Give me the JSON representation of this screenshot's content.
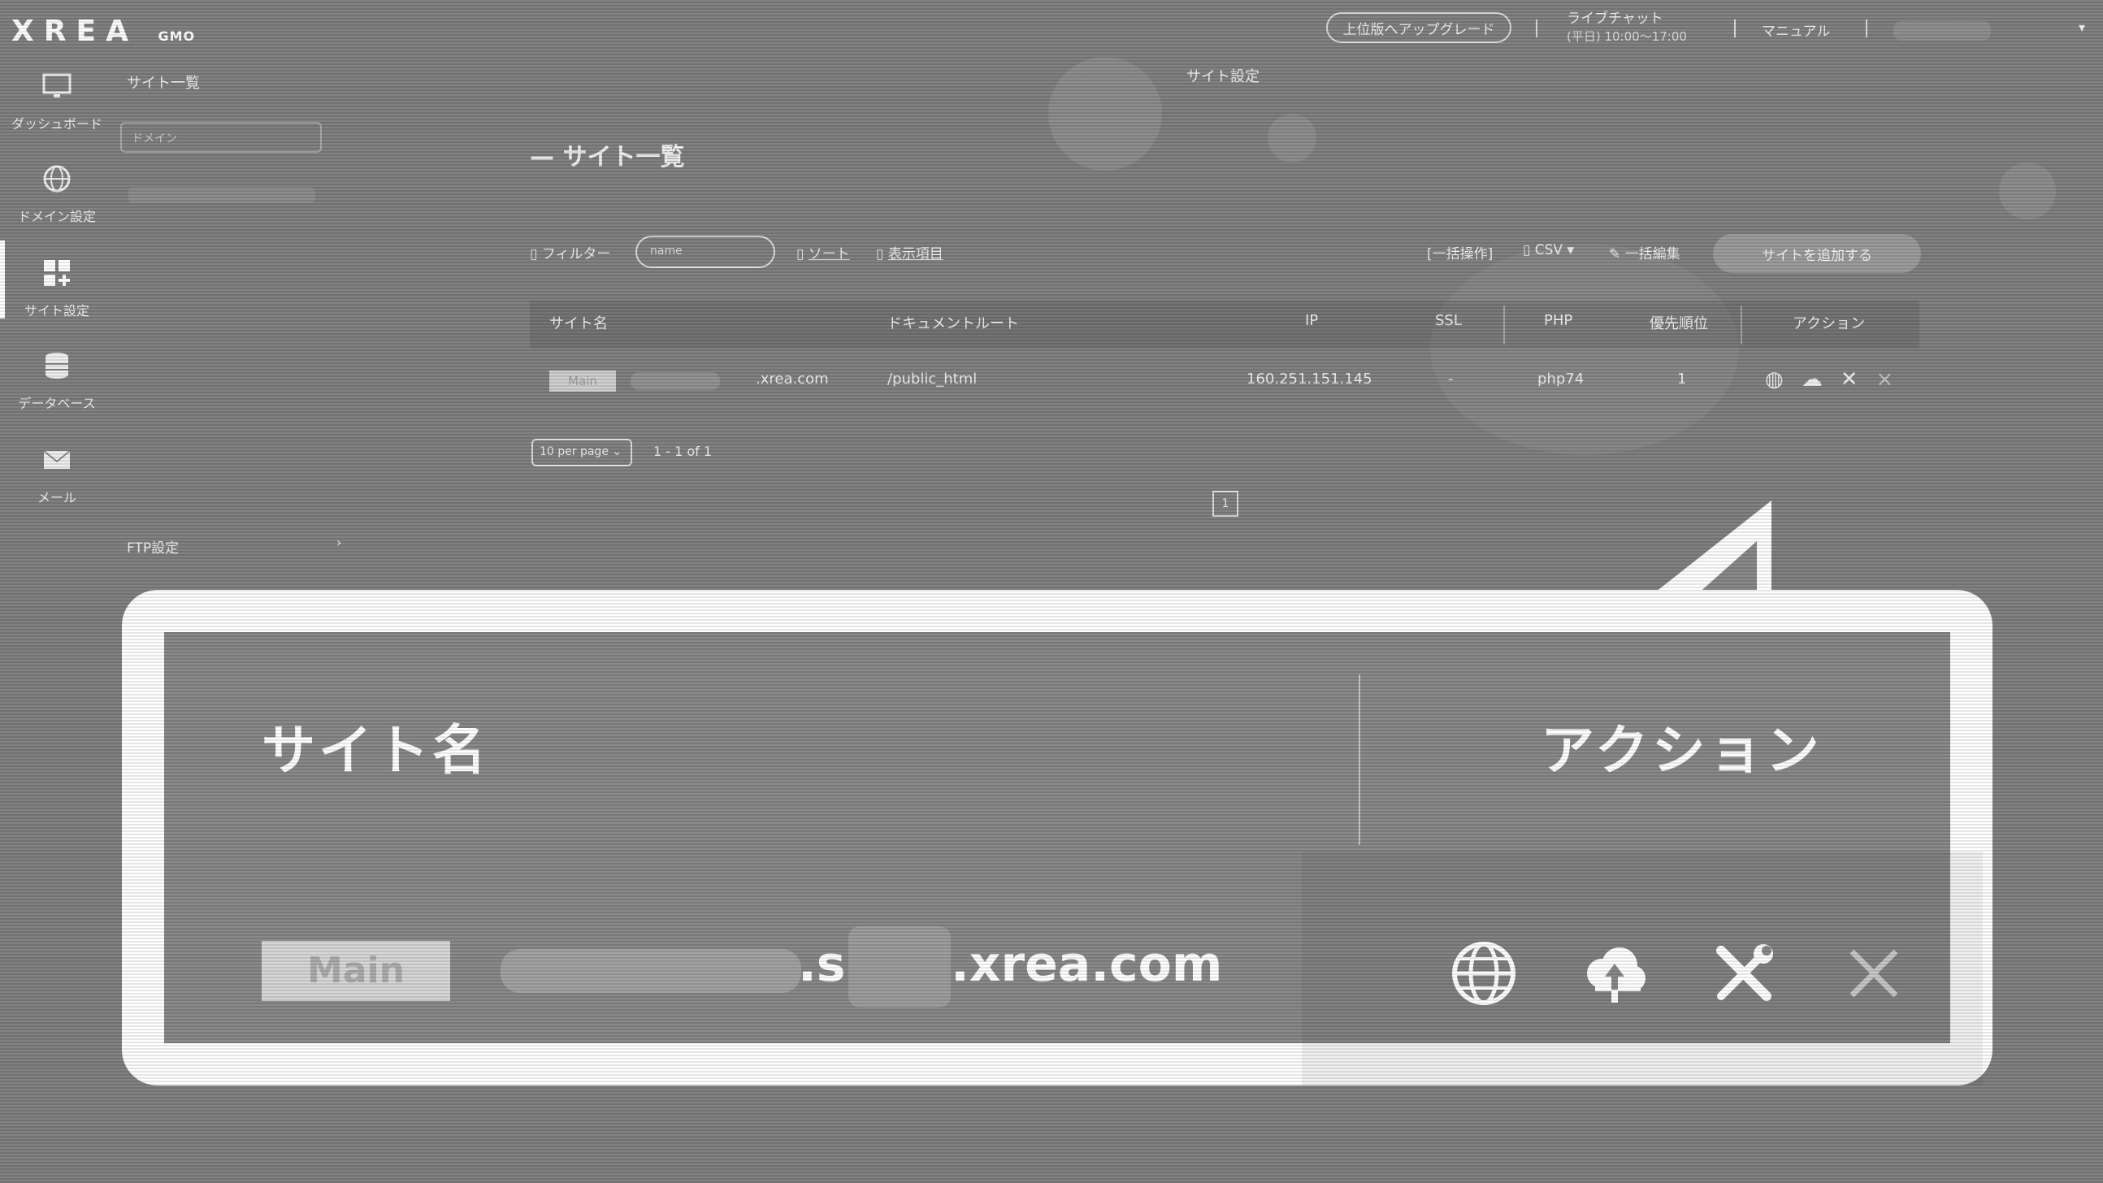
{
  "header": {
    "logo_text": "XREA",
    "logo_sub": "GMO",
    "upgrade_label": "上位版へアップグレード",
    "chat_label": "ライブチャット",
    "chat_hours": "(平日) 10:00〜17:00",
    "manual_label": "マニュアル"
  },
  "nav": {
    "items": [
      {
        "label": "ダッシュボード",
        "icon": "monitor-icon"
      },
      {
        "label": "ドメイン設定",
        "icon": "globe-icon"
      },
      {
        "label": "サイト設定",
        "icon": "site-add-icon"
      },
      {
        "label": "データベース",
        "icon": "database-icon"
      },
      {
        "label": "メール",
        "icon": "mail-icon"
      }
    ]
  },
  "sidebar2": {
    "title": "サイト一覧",
    "search_placeholder": "ドメイン",
    "ftp_label": "FTP設定",
    "ftp_arrow": "›"
  },
  "breadcrumb": "サイト設定",
  "main": {
    "title": "サイト一覧",
    "toolbar": {
      "filter_label": "フィルター",
      "filter_placeholder": "name",
      "sort_label": "ソート",
      "display_label": "表示項目",
      "bulk_label": "[一括操作]",
      "csv_label": "CSV",
      "bulk_edit_label": "一括編集",
      "add_label": "サイトを追加する"
    },
    "columns": [
      "サイト名",
      "ドキュメントルート",
      "IP",
      "SSL",
      "PHP",
      "優先順位",
      "アクション"
    ],
    "row": {
      "badge": "Main",
      "domain_suffix": ".xrea.com",
      "docroot": "/public_html",
      "ip": "160.251.151.145",
      "ssl": "-",
      "php": "php74",
      "priority": "1"
    },
    "per_page": "10 per page ⌄",
    "count": "1 - 1 of 1",
    "page": "1"
  },
  "callout": {
    "col_site": "サイト名",
    "col_action": "アクション",
    "badge": "Main",
    "domain_s": ".s",
    "domain_suffix": ".xrea.com",
    "icons": [
      "globe-icon",
      "cloud-upload-icon",
      "tools-icon",
      "close-icon"
    ]
  }
}
